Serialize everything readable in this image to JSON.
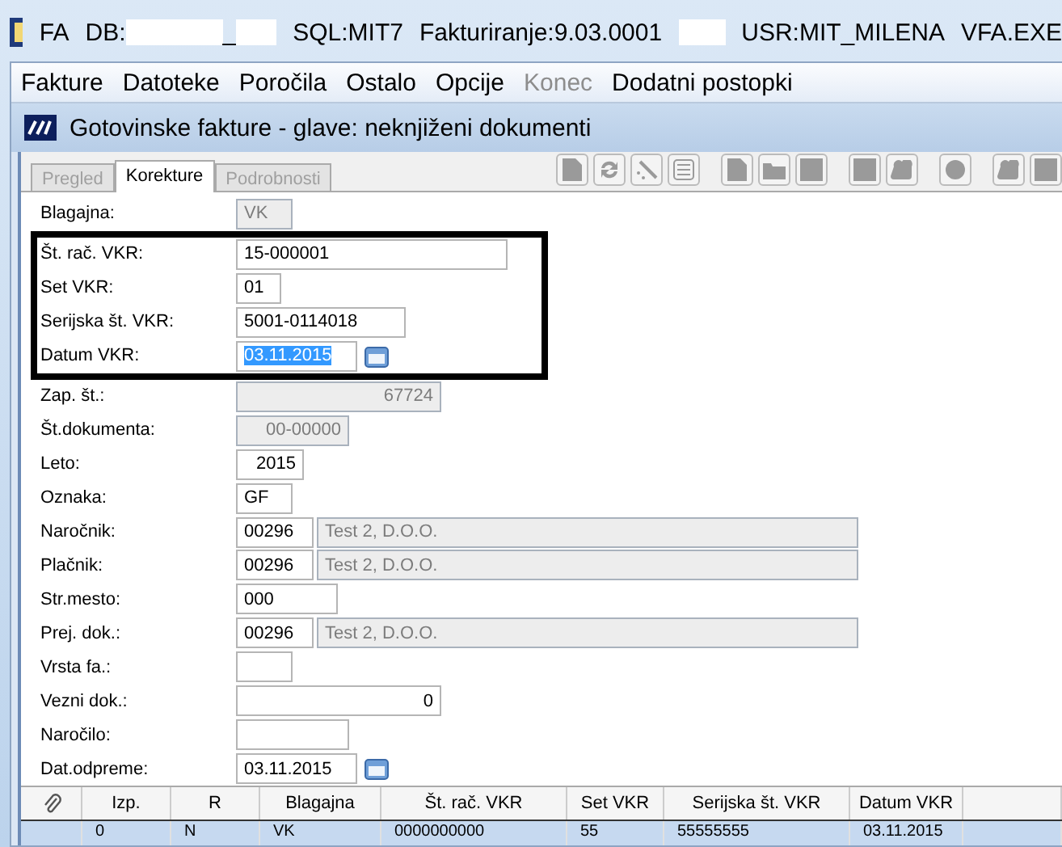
{
  "window": {
    "app": "FA",
    "db": "DB:",
    "db_tail": "_",
    "sql": "SQL:MIT7",
    "module": "Fakturiranje:9.03.0001",
    "user": "USR:MIT_MILENA",
    "exe": "VFA.EXE"
  },
  "menu": [
    {
      "label": "Fakture",
      "disabled": false
    },
    {
      "label": "Datoteke",
      "disabled": false
    },
    {
      "label": "Poročila",
      "disabled": false
    },
    {
      "label": "Ostalo",
      "disabled": false
    },
    {
      "label": "Opcije",
      "disabled": false
    },
    {
      "label": "Konec",
      "disabled": true
    },
    {
      "label": "Dodatni postopki",
      "disabled": false
    }
  ],
  "document": {
    "title": "Gotovinske fakture - glave: neknjiženi dokumenti"
  },
  "tabs": [
    {
      "label": "Pregled",
      "selected": false,
      "disabled": true
    },
    {
      "label": "Korekture",
      "selected": true,
      "disabled": false
    },
    {
      "label": "Podrobnosti",
      "selected": false,
      "disabled": true
    }
  ],
  "toolbar": [
    {
      "kind": "page"
    },
    {
      "kind": "refresh"
    },
    {
      "kind": "wand"
    },
    {
      "kind": "list"
    },
    {
      "kind": "gap"
    },
    {
      "kind": "page"
    },
    {
      "kind": "folder"
    },
    {
      "kind": "square"
    },
    {
      "kind": "gap"
    },
    {
      "kind": "square"
    },
    {
      "kind": "cloud"
    },
    {
      "kind": "gap"
    },
    {
      "kind": "globe"
    },
    {
      "kind": "gap"
    },
    {
      "kind": "cloud"
    },
    {
      "kind": "square"
    }
  ],
  "fields": [
    {
      "label": "Blagajna:",
      "value": "VK",
      "kind": "text",
      "disabled": true
    },
    {
      "kind": "group",
      "framed": true,
      "fields": [
        {
          "label": "Št. rač. VKR:",
          "value": "15-000001",
          "kind": "text",
          "disabled": false
        },
        {
          "label": "Set VKR:",
          "value": "01",
          "kind": "text",
          "disabled": false
        },
        {
          "label": "Serijska št. VKR:",
          "value": "5001-0114018",
          "kind": "text",
          "disabled": false
        },
        {
          "label": "Datum VKR:",
          "value": "03.11.2015",
          "kind": "date",
          "disabled": false,
          "selected": true
        }
      ]
    },
    {
      "label": "Zap. št.:",
      "value": "67724",
      "kind": "number",
      "disabled": true
    },
    {
      "label": "Št.dokumenta:",
      "value": "00-00000",
      "kind": "number",
      "disabled": true
    },
    {
      "label": "Leto:",
      "value": "2015",
      "kind": "number",
      "disabled": false
    },
    {
      "label": "Oznaka:",
      "value": "GF",
      "kind": "text",
      "disabled": false
    },
    {
      "label": "Naročnik:",
      "value": "00296",
      "name": "Test 2, D.O.O.",
      "kind": "lookup",
      "disabled": false
    },
    {
      "label": "Plačnik:",
      "value": "00296",
      "name": "Test 2, D.O.O.",
      "kind": "lookup",
      "disabled": false
    },
    {
      "label": "Str.mesto:",
      "value": "000",
      "kind": "text",
      "disabled": false
    },
    {
      "label": "Prej. dok.:",
      "value": "00296",
      "name": "Test 2, D.O.O.",
      "kind": "lookup",
      "disabled": false
    },
    {
      "label": "Vrsta fa.:",
      "kind": "text",
      "disabled": false
    },
    {
      "label": "Vezni dok.:",
      "value": "0",
      "kind": "number",
      "disabled": false
    },
    {
      "label": "Naročilo:",
      "kind": "text",
      "disabled": false
    },
    {
      "label": "Dat.odpreme:",
      "value": "03.11.2015",
      "kind": "date",
      "disabled": false,
      "selected": false
    }
  ],
  "table": {
    "columns": [
      "Izp.",
      "R",
      "Blagajna",
      "Št. rač. VKR",
      "Set VKR",
      "Serijska št. VKR",
      "Datum VKR"
    ],
    "rows": [
      {
        "selected": true,
        "cells": [
          "0",
          "N",
          "VK",
          "0000000000",
          "55",
          "55555555",
          "03.11.2015"
        ]
      }
    ]
  }
}
